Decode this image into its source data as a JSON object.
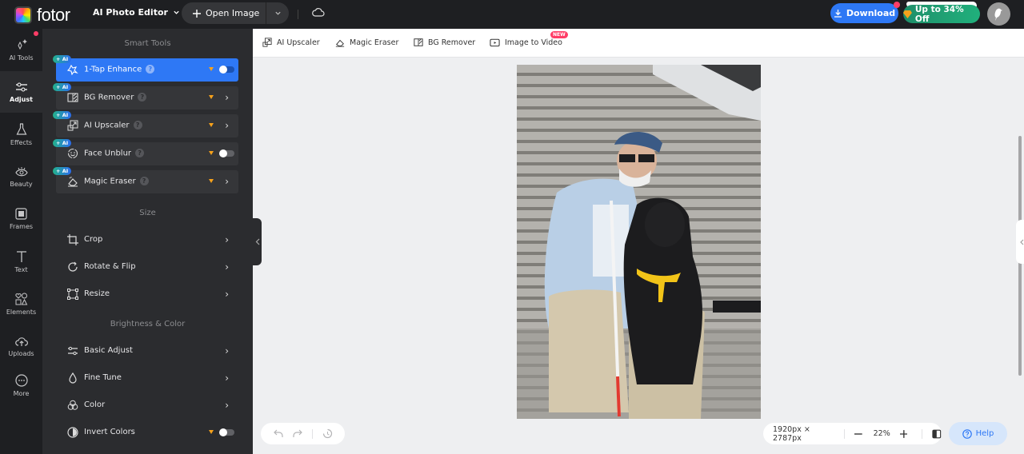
{
  "header": {
    "logo_text": "fotor",
    "app_switcher": "AI Photo Editor",
    "open_image": "Open Image",
    "download": "Download",
    "promo": "Up to 34% Off"
  },
  "rail": {
    "items": [
      {
        "label": "AI Tools",
        "icon": "sparkle-icon"
      },
      {
        "label": "Adjust",
        "icon": "sliders-icon",
        "active": true
      },
      {
        "label": "Effects",
        "icon": "flask-icon"
      },
      {
        "label": "Beauty",
        "icon": "eye-icon"
      },
      {
        "label": "Frames",
        "icon": "frame-icon"
      },
      {
        "label": "Text",
        "icon": "text-icon"
      },
      {
        "label": "Elements",
        "icon": "shapes-icon"
      },
      {
        "label": "Uploads",
        "icon": "cloud-upload-icon"
      },
      {
        "label": "More",
        "icon": "more-icon"
      }
    ]
  },
  "panel": {
    "smart_tools_title": "Smart Tools",
    "ai_badge": "AI",
    "smart_tools": [
      {
        "label": "1-Tap Enhance",
        "control": "toggle",
        "on": false,
        "active": true
      },
      {
        "label": "BG Remover",
        "control": "chevron"
      },
      {
        "label": "AI Upscaler",
        "control": "chevron"
      },
      {
        "label": "Face Unblur",
        "control": "toggle",
        "on": false
      },
      {
        "label": "Magic Eraser",
        "control": "chevron"
      }
    ],
    "size_title": "Size",
    "size_tools": [
      {
        "label": "Crop"
      },
      {
        "label": "Rotate & Flip"
      },
      {
        "label": "Resize"
      }
    ],
    "brightness_title": "Brightness & Color",
    "brightness_tools": [
      {
        "label": "Basic Adjust"
      },
      {
        "label": "Fine Tune"
      },
      {
        "label": "Color"
      },
      {
        "label": "Invert Colors",
        "control": "toggle",
        "on": false
      }
    ]
  },
  "quick_tools": [
    {
      "label": "AI Upscaler"
    },
    {
      "label": "Magic Eraser"
    },
    {
      "label": "BG Remover"
    },
    {
      "label": "Image to Video",
      "badge": "NEW"
    }
  ],
  "canvas": {
    "image_alt": "Senior man with cane and black guide dog sitting on stone steps"
  },
  "footer": {
    "dimensions": "1920px × 2787px",
    "zoom": "22%",
    "help": "Help"
  }
}
